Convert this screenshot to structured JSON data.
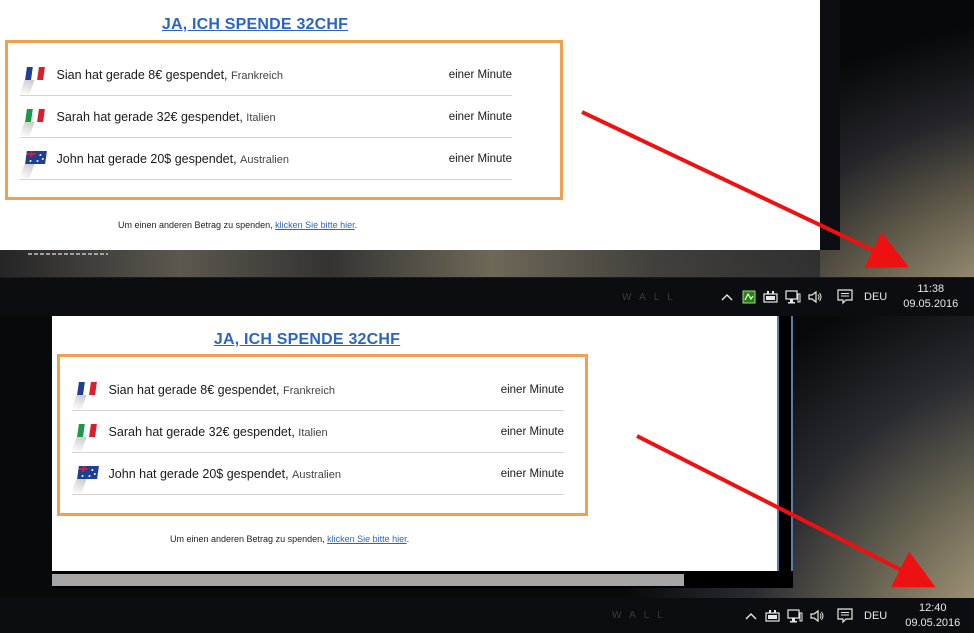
{
  "screenshots": [
    {
      "title": "JA, ICH SPENDE 32CHF",
      "donations": [
        {
          "flag": "france",
          "text": "Sian hat gerade 8€ gespendet, ",
          "country": "Frankreich",
          "time": "einer Minute"
        },
        {
          "flag": "italy",
          "text": "Sarah hat gerade 32€ gespendet, ",
          "country": "Italien",
          "time": "einer Minute"
        },
        {
          "flag": "australia",
          "text": "John hat gerade 20$ gespendet, ",
          "country": "Australien",
          "time": "einer Minute"
        }
      ],
      "other_amount": {
        "prefix": "Um einen anderen Betrag zu spenden, ",
        "link": "klicken Sie bitte hier",
        "suffix": "."
      },
      "taskbar": {
        "language": "DEU",
        "time": "11:38",
        "date": "09.05.2016"
      }
    },
    {
      "title": "JA, ICH SPENDE 32CHF",
      "donations": [
        {
          "flag": "france",
          "text": "Sian hat gerade 8€ gespendet, ",
          "country": "Frankreich",
          "time": "einer Minute"
        },
        {
          "flag": "italy",
          "text": "Sarah hat gerade 32€ gespendet, ",
          "country": "Italien",
          "time": "einer Minute"
        },
        {
          "flag": "australia",
          "text": "John hat gerade 20$ gespendet, ",
          "country": "Australien",
          "time": "einer Minute"
        }
      ],
      "other_amount": {
        "prefix": "Um einen anderen Betrag zu spenden, ",
        "link": "klicken Sie bitte hier",
        "suffix": "."
      },
      "taskbar": {
        "language": "DEU",
        "time": "12:40",
        "date": "09.05.2016"
      }
    }
  ],
  "colors": {
    "title_link": "#2a66c0",
    "box_border": "#f0a150",
    "arrow": "#ee1111",
    "taskbar": "#0c0d10"
  },
  "icons": [
    "chevron-up-icon",
    "app-tray-icon",
    "battery-icon",
    "network-icon",
    "volume-icon",
    "notification-icon"
  ]
}
